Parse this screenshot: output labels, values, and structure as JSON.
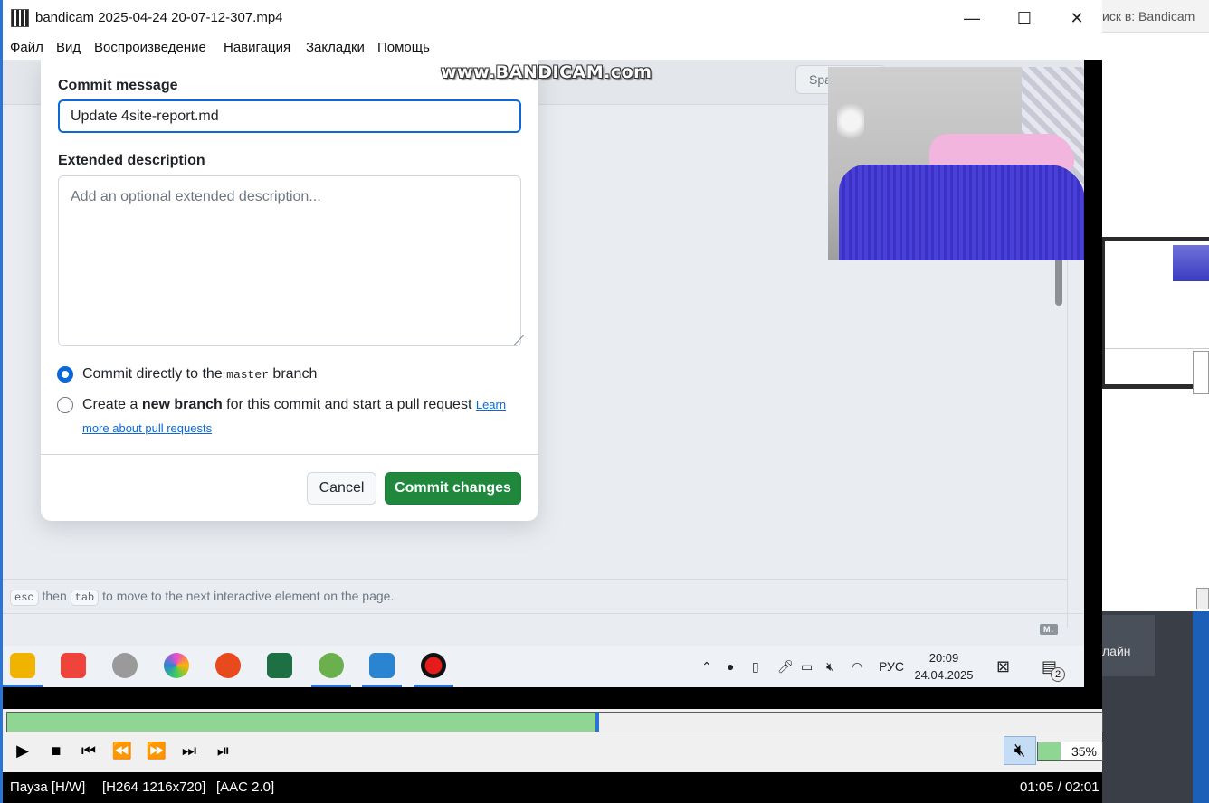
{
  "window": {
    "title": "bandicam 2025-04-24 20-07-12-307.mp4",
    "minimize": "—",
    "maximize": "☐",
    "close": "✕"
  },
  "menu": [
    "Файл",
    "Вид",
    "Воспроизведение",
    "Навигация",
    "Закладки",
    "Помощь"
  ],
  "background": {
    "search_text": "иск в: Bandicam",
    "chip_text": "лайн"
  },
  "watermark": "www.BANDICAM.com",
  "page": {
    "spa_text": "Spa"
  },
  "dialog": {
    "commit_message_label": "Commit message",
    "commit_message_value": "Update 4site-report.md",
    "extended_label": "Extended description",
    "extended_placeholder": "Add an optional extended description...",
    "option1_pre": "Commit directly to the ",
    "option1_code": "master",
    "option1_post": " branch",
    "option1_checked": true,
    "option2_pre": "Create a ",
    "option2_bold": "new branch",
    "option2_post": " for this commit and start a pull request ",
    "option2_link1": "Learn",
    "option2_link2": "more about pull requests",
    "cancel_label": "Cancel",
    "commit_label": "Commit changes"
  },
  "hint": {
    "key1": "esc",
    "then": "then",
    "key2": "tab",
    "rest": "to move to the next interactive element on the page."
  },
  "md_badge": "M↓",
  "taskbar": {
    "apps": [
      {
        "name": "file-explorer",
        "color": "#f0b400"
      },
      {
        "name": "anydesk",
        "color": "#ef443b"
      },
      {
        "name": "app-gray",
        "color": "#9a9a9a"
      },
      {
        "name": "color-wheel",
        "color": "#e94bd0"
      },
      {
        "name": "wps-office",
        "color": "#e8491d"
      },
      {
        "name": "excel",
        "color": "#1d7044"
      },
      {
        "name": "utorrent",
        "color": "#6ab04c"
      },
      {
        "name": "vscode",
        "color": "#2a84d2"
      },
      {
        "name": "bandicam-record",
        "color": "#e51c1c"
      }
    ],
    "language": "РУС",
    "time": "20:09",
    "date": "24.04.2025",
    "notifications": "2"
  },
  "player": {
    "progress": 0.537,
    "volume_percent": "35%",
    "volume": 0.35,
    "status_mode": "Пауза [H/W]",
    "status_video": "[H264 1216x720]",
    "status_audio": "[AAC 2.0]",
    "time": "01:05 / 02:01"
  }
}
